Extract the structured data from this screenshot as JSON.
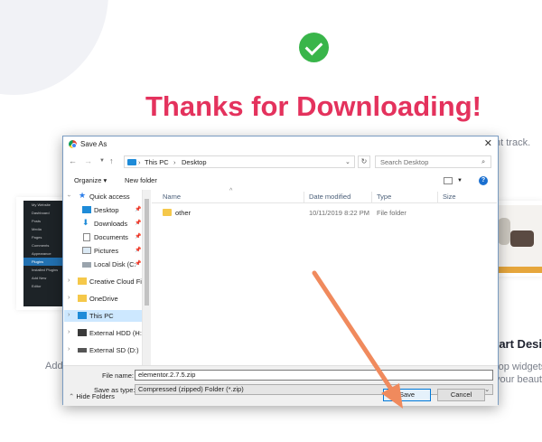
{
  "page": {
    "heading": "Thanks for Downloading!",
    "bg_right_text": "nt track.",
    "bg_left_text": "Add",
    "bg_card_title": "tart Desig",
    "bg_card_text1": "rop widgets",
    "bg_card_text2": "your beautif",
    "wp_menu": [
      "My Website",
      "Dashboard",
      "Posts",
      "Media",
      "Pages",
      "Comments",
      "Appearance",
      "Plugins",
      "Installed Plugins",
      "Add New",
      "Editor"
    ]
  },
  "dialog": {
    "title": "Save As",
    "address": {
      "segments": [
        "This PC",
        "Desktop"
      ]
    },
    "search_placeholder": "Search Desktop",
    "toolbar": {
      "organize": "Organize",
      "new_folder": "New folder"
    },
    "nav_items": [
      {
        "label": "Quick access",
        "icon": "star-icon"
      },
      {
        "label": "Desktop",
        "icon": "desktop-folder-icon"
      },
      {
        "label": "Downloads",
        "icon": "downloads-icon"
      },
      {
        "label": "Documents",
        "icon": "documents-icon"
      },
      {
        "label": "Pictures",
        "icon": "pictures-icon"
      },
      {
        "label": "Local Disk (C:",
        "icon": "disk-icon"
      },
      {
        "label": "Creative Cloud Fil",
        "icon": "creative-cloud-icon"
      },
      {
        "label": "OneDrive",
        "icon": "onedrive-icon"
      },
      {
        "label": "This PC",
        "icon": "computer-icon"
      },
      {
        "label": "External HDD (H:)",
        "icon": "drive-icon"
      },
      {
        "label": "External SD (D:)",
        "icon": "drive-icon"
      }
    ],
    "columns": [
      "Name",
      "Date modified",
      "Type",
      "Size"
    ],
    "files": [
      {
        "name": "other",
        "date": "10/11/2019 8:22 PM",
        "type": "File folder",
        "size": ""
      }
    ],
    "file_name_label": "File name:",
    "file_name_value": "elementor.2.7.5.zip",
    "save_as_type_label": "Save as type:",
    "save_as_type_value": "Compressed (zipped) Folder (*.zip)",
    "hide_folders": "Hide Folders",
    "save": "Save",
    "cancel": "Cancel"
  },
  "colors": {
    "accent": "#e4325d",
    "success": "#39b54a",
    "annotation_arrow": "#f08a5d"
  }
}
